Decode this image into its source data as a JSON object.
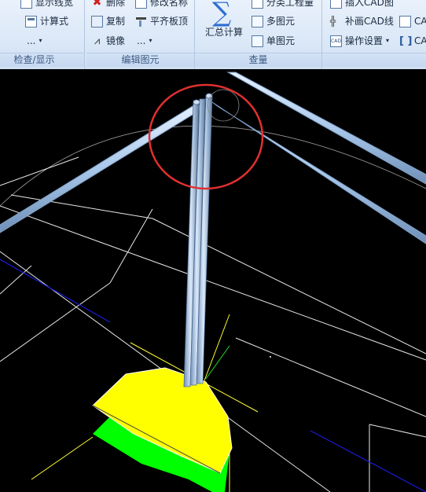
{
  "ribbon": {
    "groups": [
      {
        "label": "检查/显示",
        "buttons": [
          "显示线宽",
          "计算式",
          "..."
        ]
      },
      {
        "label": "编辑图元",
        "buttons": [
          "删除",
          "复制",
          "镜像",
          "修改名称",
          "平齐板顶",
          "..."
        ]
      },
      {
        "label": "查量",
        "big_button": "汇总计算",
        "buttons": [
          "分类工程量",
          "多图元",
          "单图元"
        ]
      },
      {
        "label": "",
        "buttons": [
          "插入CAD图",
          "补画CAD线",
          "操作设置",
          "CA",
          "CA"
        ]
      }
    ]
  },
  "viewport": {
    "background": "#000000",
    "highlight_color": "#e03030",
    "fill_yellow": "#ffff00",
    "fill_green": "#00ff00",
    "beam_color": "#a9c8ea"
  }
}
